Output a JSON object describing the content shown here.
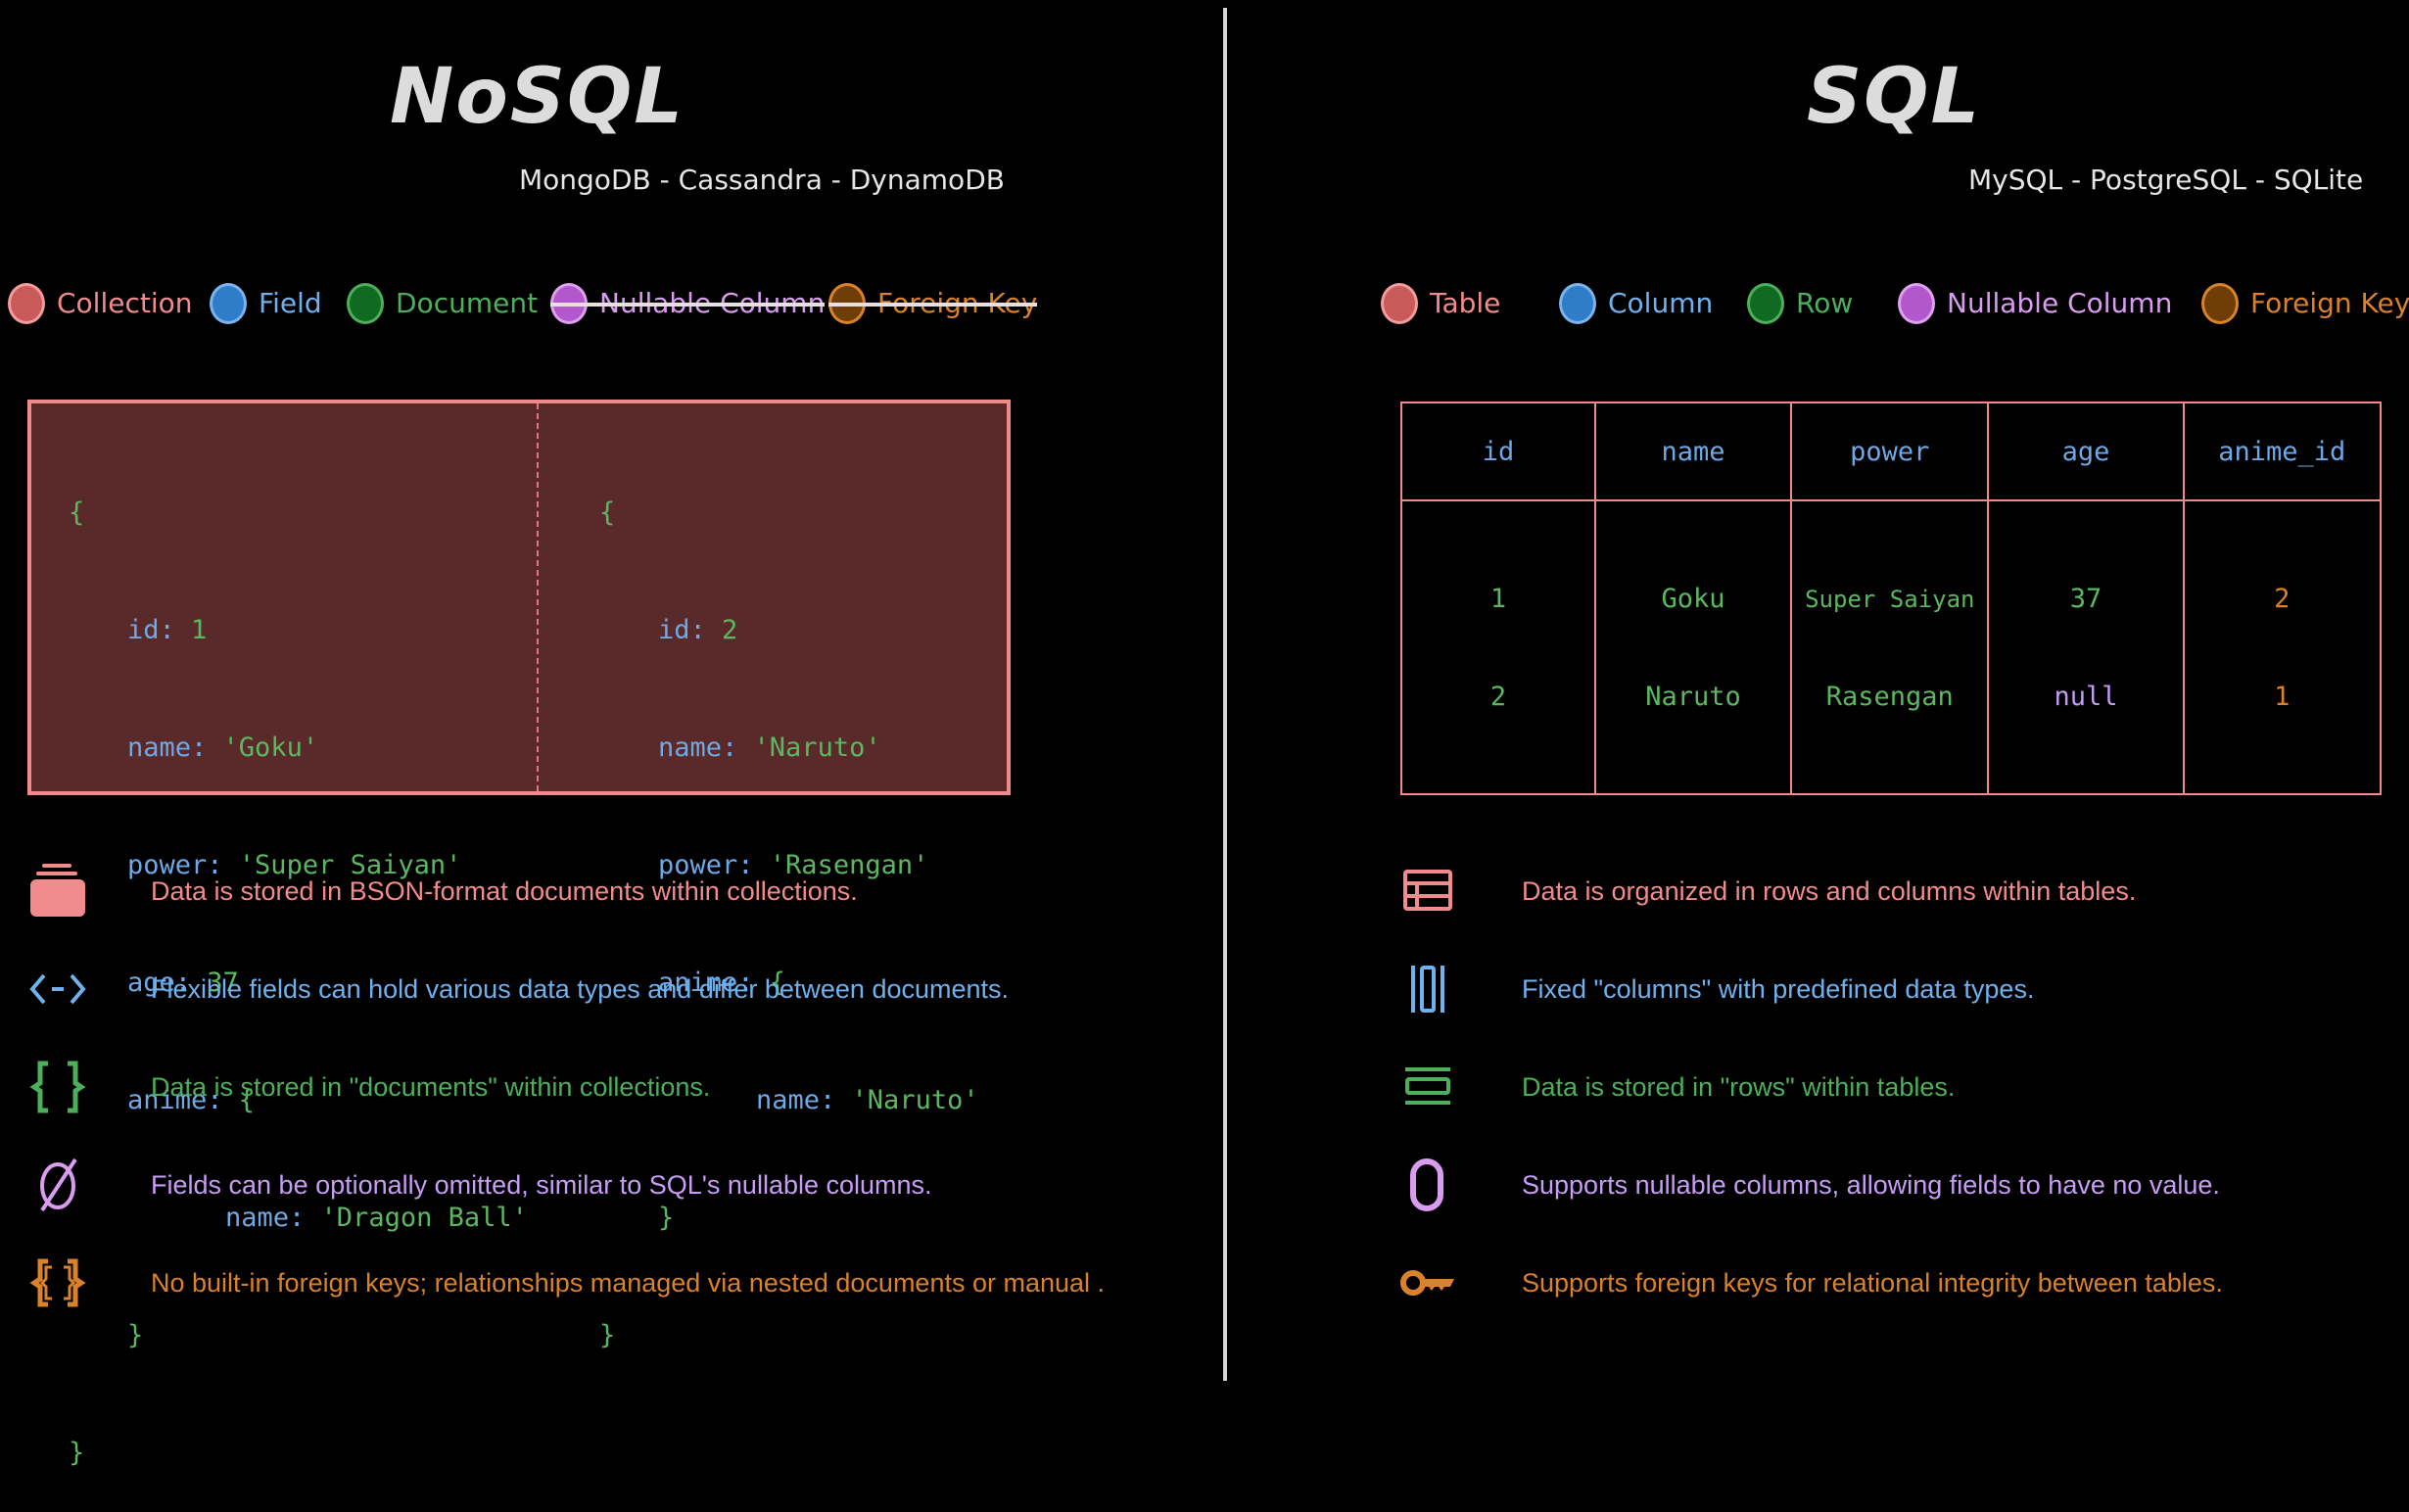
{
  "nosql": {
    "title": "NoSQL",
    "subtitle": "MongoDB - Cassandra - DynamoDB",
    "legend": [
      {
        "label": "Collection",
        "color": "#c85a5a",
        "border": "#f59a9a",
        "text_color": "#f28b8b",
        "struck": false
      },
      {
        "label": "Field",
        "color": "#2f7cc8",
        "border": "#79b4ef",
        "text_color": "#6fb1ee",
        "struck": false
      },
      {
        "label": "Document",
        "color": "#106a22",
        "border": "#4caf5a",
        "text_color": "#4caf5a",
        "struck": false
      },
      {
        "label": "Nullable Column",
        "color": "#b258cc",
        "border": "#e0a0f0",
        "text_color": "#d99cf0",
        "struck": true
      },
      {
        "label": "Foreign Key",
        "color": "#6e3e06",
        "border": "#d9822b",
        "text_color": "#d9822b",
        "struck": true
      }
    ],
    "documents": [
      {
        "open": "{",
        "fields": [
          {
            "key": "id",
            "value": "1"
          },
          {
            "key": "name",
            "value": "'Goku'"
          },
          {
            "key": "power",
            "value": "'Super Saiyan'"
          },
          {
            "key": "age",
            "value": "37"
          },
          {
            "key": "anime",
            "value": "{"
          }
        ],
        "nested": {
          "key": "name",
          "value": "'Dragon Ball'"
        },
        "nested_close": "}",
        "close": "}"
      },
      {
        "open": "{",
        "fields": [
          {
            "key": "id",
            "value": "2"
          },
          {
            "key": "name",
            "value": "'Naruto'"
          },
          {
            "key": "power",
            "value": "'Rasengan'"
          },
          {
            "key": "anime",
            "value": "{"
          }
        ],
        "nested": {
          "key": "name",
          "value": "'Naruto'"
        },
        "nested_close": "}",
        "close": "}"
      }
    ],
    "descriptions": [
      {
        "icon": "collection-icon",
        "text": "Data is stored in BSON-format documents within collections."
      },
      {
        "icon": "field-code-icon",
        "text": "Flexible fields can hold various data types and differ between documents."
      },
      {
        "icon": "braces-icon",
        "text": "Data is stored in \"documents\" within collections."
      },
      {
        "icon": "empty-set-icon",
        "text": "Fields can be optionally omitted, similar to SQL's nullable columns."
      },
      {
        "icon": "double-braces-icon",
        "text": "No built-in foreign keys; relationships managed via nested documents or manual  ."
      }
    ]
  },
  "sql": {
    "title": "SQL",
    "subtitle": "MySQL - PostgreSQL - SQLite",
    "legend": [
      {
        "label": "Table",
        "color": "#c85a5a",
        "border": "#f59a9a",
        "text_color": "#f28b8b",
        "struck": false
      },
      {
        "label": "Column",
        "color": "#2f7cc8",
        "border": "#79b4ef",
        "text_color": "#6fb1ee",
        "struck": false
      },
      {
        "label": "Row",
        "color": "#106a22",
        "border": "#4caf5a",
        "text_color": "#4caf5a",
        "struck": false
      },
      {
        "label": "Nullable Column",
        "color": "#b258cc",
        "border": "#e0a0f0",
        "text_color": "#d99cf0",
        "struck": false
      },
      {
        "label": "Foreign Key",
        "color": "#6e3e06",
        "border": "#d9822b",
        "text_color": "#d9822b",
        "struck": false
      }
    ],
    "table": {
      "columns": [
        "id",
        "name",
        "power",
        "age",
        "anime_id"
      ],
      "rows": [
        [
          "1",
          "Goku",
          "Super Saiyan",
          "37",
          "2"
        ],
        [
          "2",
          "Naruto",
          "Rasengan",
          "null",
          "1"
        ]
      ]
    },
    "descriptions": [
      {
        "icon": "table-icon",
        "text": "Data is organized in rows and columns within tables."
      },
      {
        "icon": "columns-icon",
        "text": "Fixed \"columns\" with predefined data types."
      },
      {
        "icon": "rows-icon",
        "text": "Data is stored in \"rows\" within tables."
      },
      {
        "icon": "zero-icon",
        "text": "Supports nullable columns, allowing fields to have no value."
      },
      {
        "icon": "key-icon",
        "text": "Supports foreign keys for relational integrity between tables."
      }
    ]
  },
  "colors": {
    "background": "#000000",
    "divider": "#d6d6d6",
    "collection_border": "#f08a8a",
    "collection_fill": "#5a2a2a",
    "key_text": "#6fa8e6",
    "value_text": "#5cb860",
    "null_text": "#c39cf2",
    "fk_text": "#d9822b"
  }
}
